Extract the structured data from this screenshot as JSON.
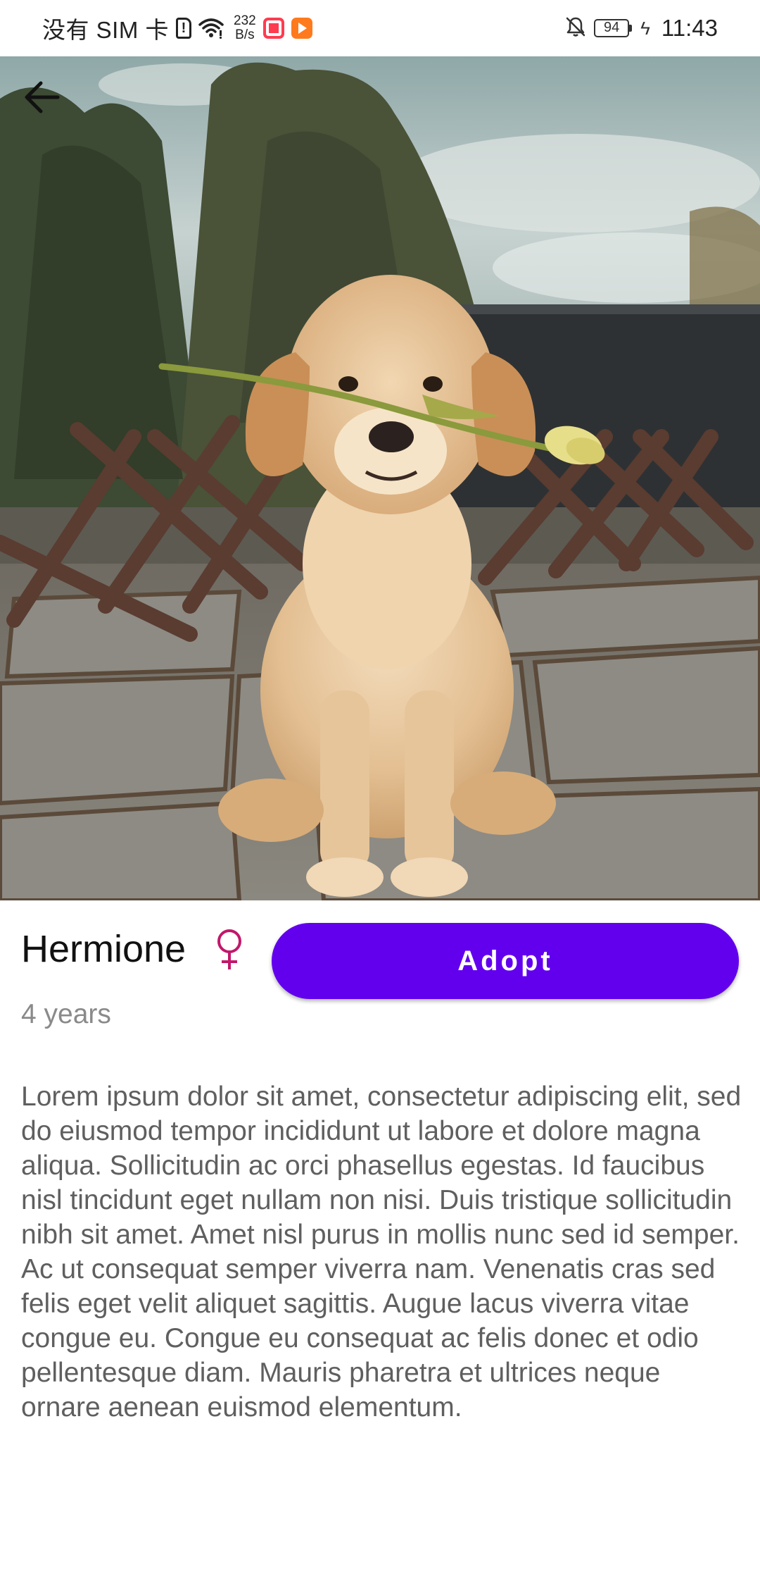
{
  "status_bar": {
    "carrier": "没有 SIM 卡",
    "net_speed_value": "232",
    "net_speed_unit": "B/s",
    "battery_level": "94",
    "time": "11:43",
    "icons": [
      "sim-alert-icon",
      "wifi-icon",
      "app-notification-icon",
      "video-app-icon",
      "bell-muted-icon",
      "battery-icon",
      "charging-icon"
    ]
  },
  "hero": {
    "image_subject": "golden retriever puppy holding a yellow tulip",
    "back_icon": "arrow-left-icon"
  },
  "pet": {
    "name": "Hermione",
    "gender_icon": "female-icon",
    "age": "4 years",
    "description": "Lorem ipsum dolor sit amet, consectetur adipiscing elit, sed do eiusmod tempor incididunt ut labore et dolore magna aliqua. Sollicitudin ac orci phasellus egestas. Id faucibus nisl tincidunt eget nullam non nisi. Duis tristique sollicitudin nibh sit amet. Amet nisl purus in mollis nunc sed id semper. Ac ut consequat semper viverra nam. Venenatis cras sed felis eget velit aliquet sagittis. Augue lacus viverra vitae congue eu. Congue eu consequat ac felis donec et odio pellentesque diam. Mauris pharetra et ultrices neque ornare aenean euismod elementum."
  },
  "actions": {
    "adopt_label": "Adopt"
  },
  "colors": {
    "accent": "#6200ee",
    "gender": "#c2186b",
    "age_text": "#8a8a8a",
    "body_text": "#5f5f5f"
  }
}
